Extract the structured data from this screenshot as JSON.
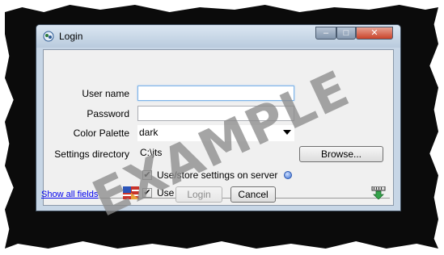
{
  "window": {
    "title": "Login",
    "min_glyph": "–",
    "max_glyph": "□",
    "close_glyph": "✕"
  },
  "form": {
    "username_label": "User name",
    "username_value": "",
    "password_label": "Password",
    "password_value": "",
    "palette_label": "Color Palette",
    "palette_value": "dark",
    "settings_dir_label": "Settings directory",
    "settings_dir_value": "C:\\jts",
    "browse_label": "Browse...",
    "use_server_label": "Use/store settings on server",
    "use_server_checked": true,
    "use_ssl_label": "Use SSL",
    "use_ssl_checked": true
  },
  "footer": {
    "show_all_fields": "Show all fields",
    "login_label": "Login",
    "cancel_label": "Cancel"
  },
  "watermark": "EXAMPLE",
  "icons": {
    "app": "app-icon",
    "help": "help-icon",
    "flag": "flag-icon",
    "download": "download-icon"
  },
  "colors": {
    "link": "#0000ee",
    "title_bar": "#c7d6e6",
    "close_button": "#c9432a",
    "watermark": "#8c8c8c"
  }
}
